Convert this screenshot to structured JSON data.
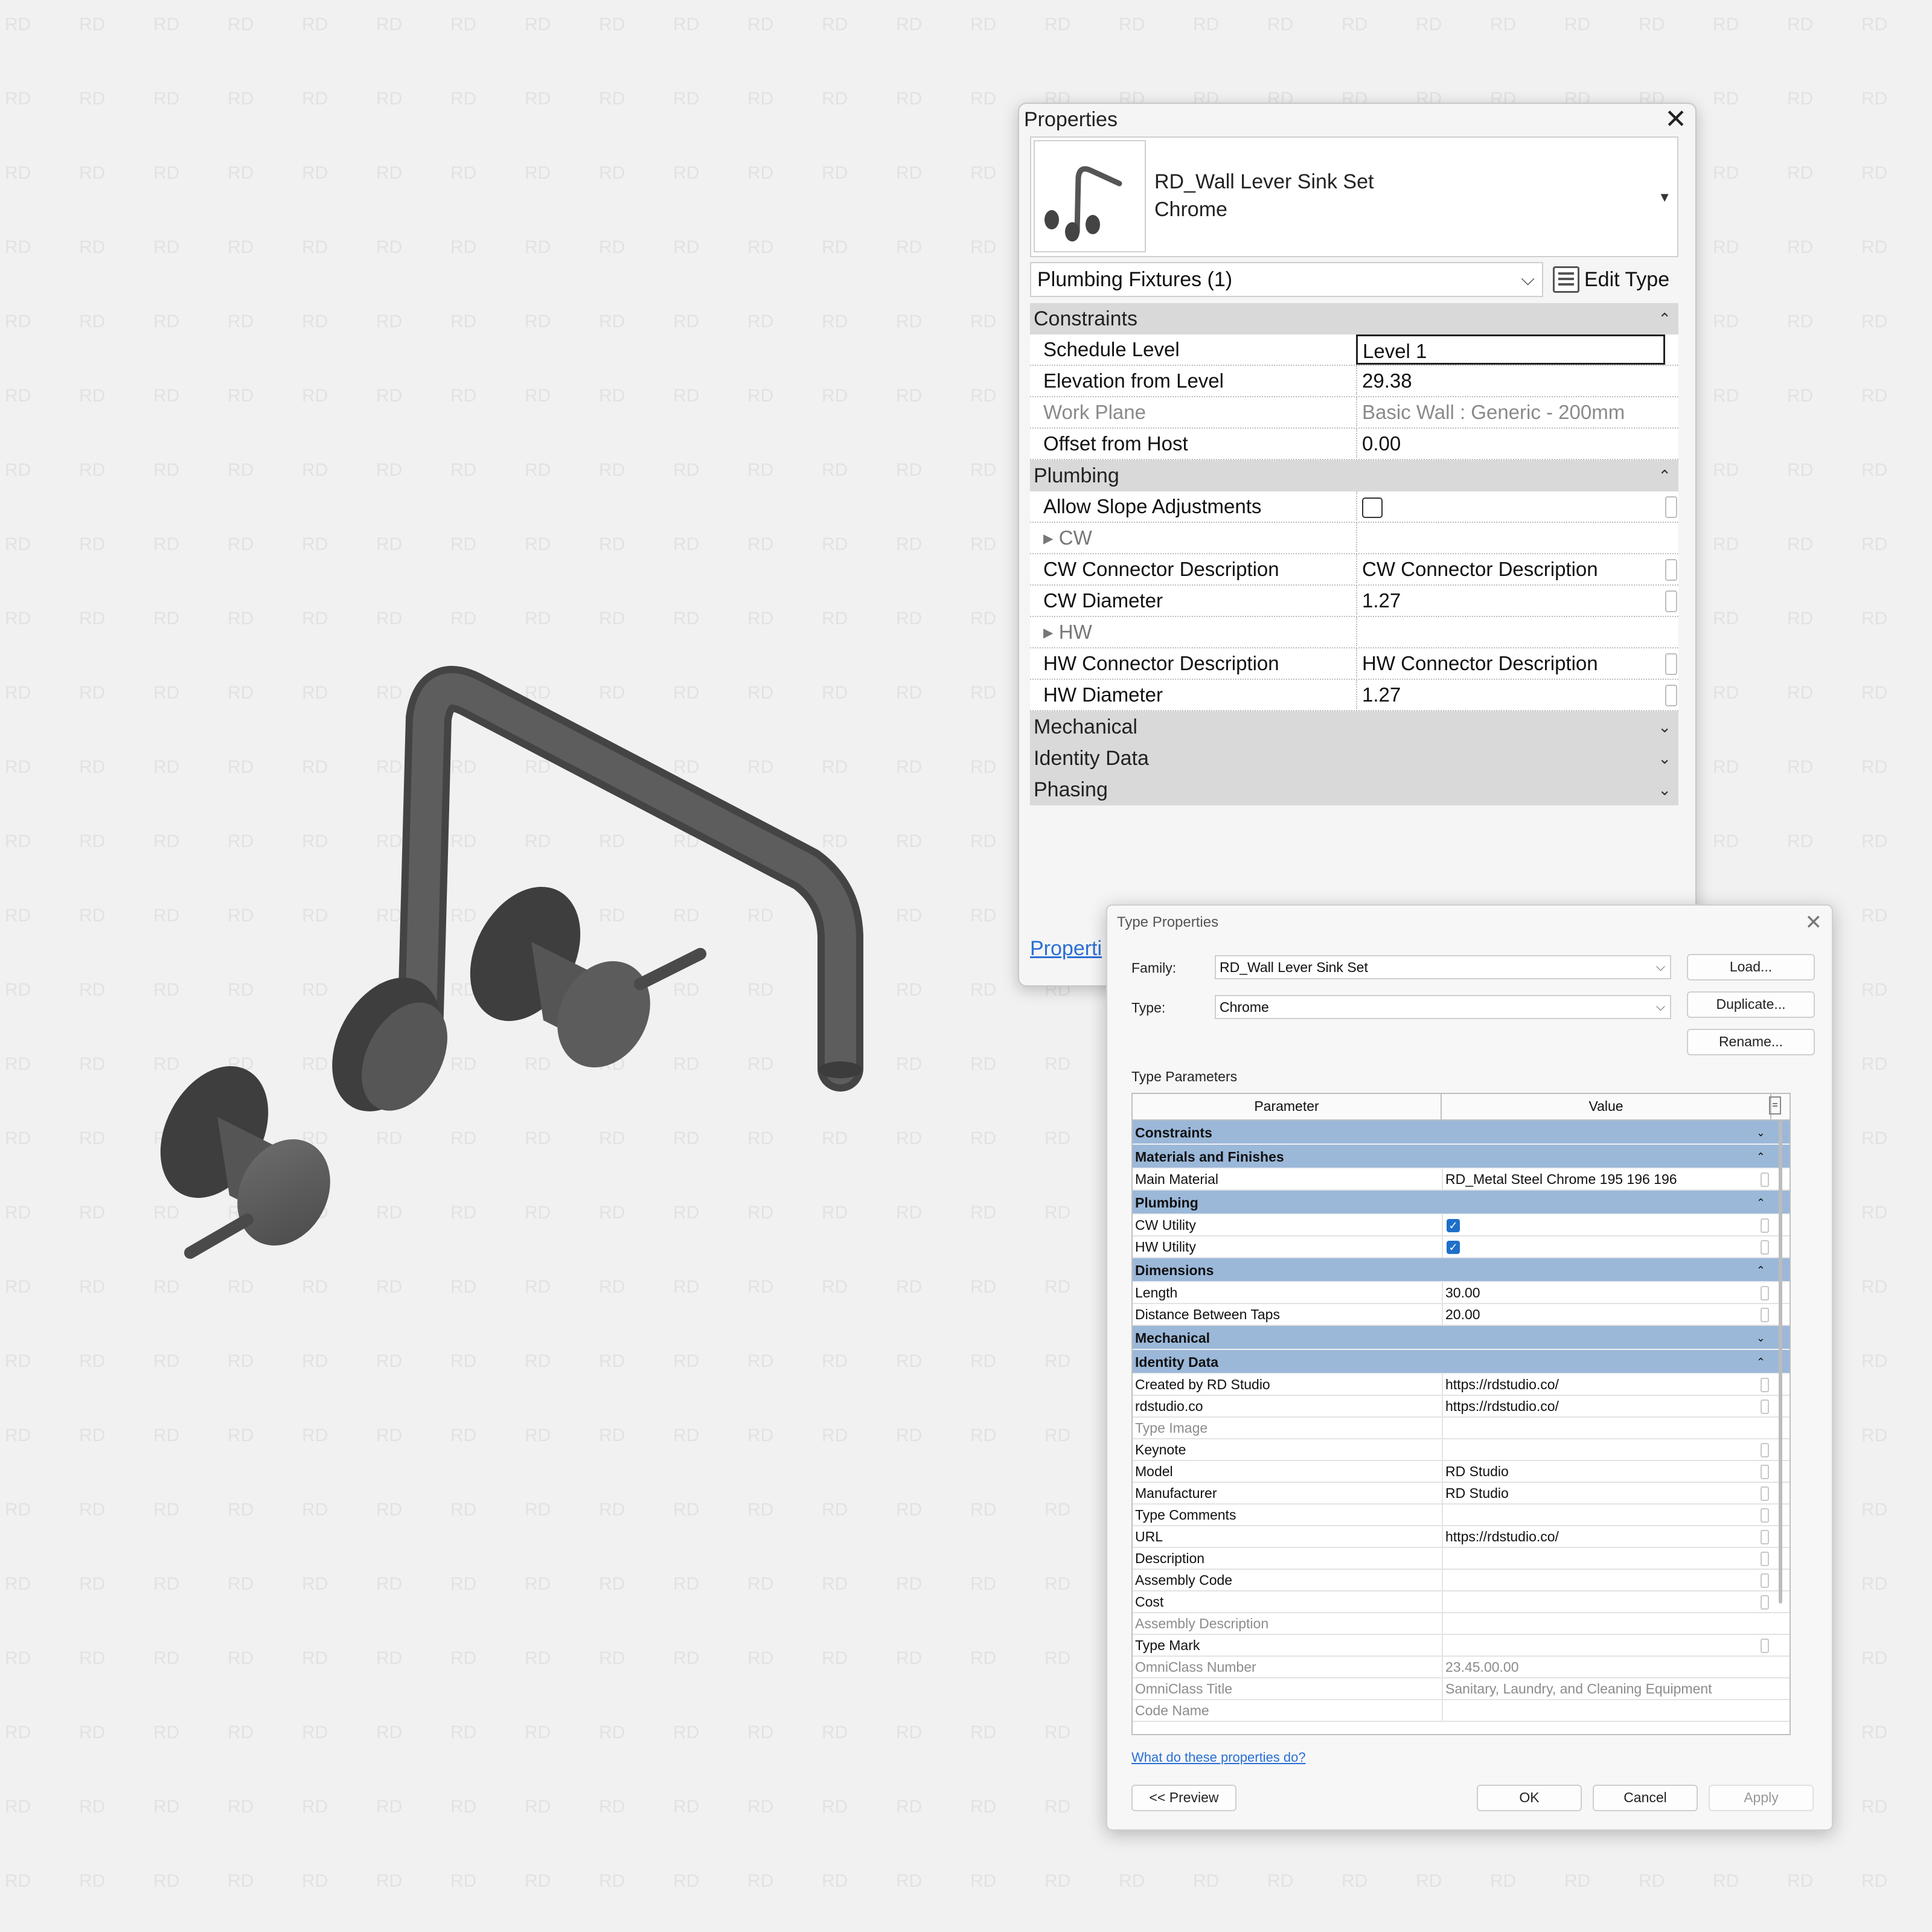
{
  "properties": {
    "title": "Properties",
    "family_name": "RD_Wall Lever Sink Set",
    "type_name": "Chrome",
    "category_selector": "Plumbing Fixtures (1)",
    "edit_type_label": "Edit Type",
    "groups": [
      {
        "name": "Constraints",
        "expanded": true,
        "rows": [
          {
            "name": "Schedule Level",
            "value": "Level 1",
            "editing": true
          },
          {
            "name": "Elevation from Level",
            "value": "29.38"
          },
          {
            "name": "Work Plane",
            "value": "Basic Wall : Generic - 200mm",
            "disabled": true
          },
          {
            "name": "Offset from Host",
            "value": "0.00"
          }
        ]
      },
      {
        "name": "Plumbing",
        "expanded": true,
        "rows": [
          {
            "name": "Allow Slope Adjustments",
            "checkbox": true,
            "checked": false
          },
          {
            "name": "CW",
            "subheader": true
          },
          {
            "name": "CW Connector Description",
            "value": "CW Connector Description"
          },
          {
            "name": "CW Diameter",
            "value": "1.27"
          },
          {
            "name": "HW",
            "subheader": true
          },
          {
            "name": "HW Connector Description",
            "value": "HW Connector Description"
          },
          {
            "name": "HW Diameter",
            "value": "1.27"
          }
        ]
      },
      {
        "name": "Mechanical",
        "expanded": false
      },
      {
        "name": "Identity Data",
        "expanded": false
      },
      {
        "name": "Phasing",
        "expanded": false
      }
    ],
    "footer_link": "Properti"
  },
  "type_properties": {
    "title": "Type Properties",
    "family_label": "Family:",
    "family_value": "RD_Wall Lever Sink Set",
    "type_label": "Type:",
    "type_value": "Chrome",
    "load_label": "Load...",
    "duplicate_label": "Duplicate...",
    "rename_label": "Rename...",
    "section_label": "Type Parameters",
    "col_parameter": "Parameter",
    "col_value": "Value",
    "col_extra": "=",
    "groups": [
      {
        "name": "Constraints",
        "expanded": false,
        "rows": []
      },
      {
        "name": "Materials and Finishes",
        "expanded": true,
        "rows": [
          {
            "name": "Main Material",
            "value": "RD_Metal Steel Chrome 195 196 196"
          }
        ]
      },
      {
        "name": "Plumbing",
        "expanded": true,
        "rows": [
          {
            "name": "CW Utility",
            "checked": true
          },
          {
            "name": "HW Utility",
            "checked": true
          }
        ]
      },
      {
        "name": "Dimensions",
        "expanded": true,
        "rows": [
          {
            "name": "Length",
            "value": "30.00"
          },
          {
            "name": "Distance Between Taps",
            "value": "20.00"
          }
        ]
      },
      {
        "name": "Mechanical",
        "expanded": false,
        "rows": []
      },
      {
        "name": "Identity Data",
        "expanded": true,
        "rows": [
          {
            "name": "Created by RD Studio",
            "value": "https://rdstudio.co/"
          },
          {
            "name": "rdstudio.co",
            "value": "https://rdstudio.co/"
          },
          {
            "name": "Type Image",
            "value": "",
            "disabled": true
          },
          {
            "name": "Keynote",
            "value": ""
          },
          {
            "name": "Model",
            "value": "RD Studio"
          },
          {
            "name": "Manufacturer",
            "value": "RD Studio"
          },
          {
            "name": "Type Comments",
            "value": ""
          },
          {
            "name": "URL",
            "value": "https://rdstudio.co/"
          },
          {
            "name": "Description",
            "value": ""
          },
          {
            "name": "Assembly Code",
            "value": ""
          },
          {
            "name": "Cost",
            "value": ""
          },
          {
            "name": "Assembly Description",
            "value": "",
            "disabled": true
          },
          {
            "name": "Type Mark",
            "value": ""
          },
          {
            "name": "OmniClass Number",
            "value": "23.45.00.00",
            "disabled": true
          },
          {
            "name": "OmniClass Title",
            "value": "Sanitary, Laundry, and Cleaning Equipment",
            "disabled": true
          },
          {
            "name": "Code Name",
            "value": "",
            "disabled": true
          }
        ]
      }
    ],
    "help_link": "What do these properties do?",
    "preview_label": "<< Preview",
    "ok_label": "OK",
    "cancel_label": "Cancel",
    "apply_label": "Apply"
  }
}
